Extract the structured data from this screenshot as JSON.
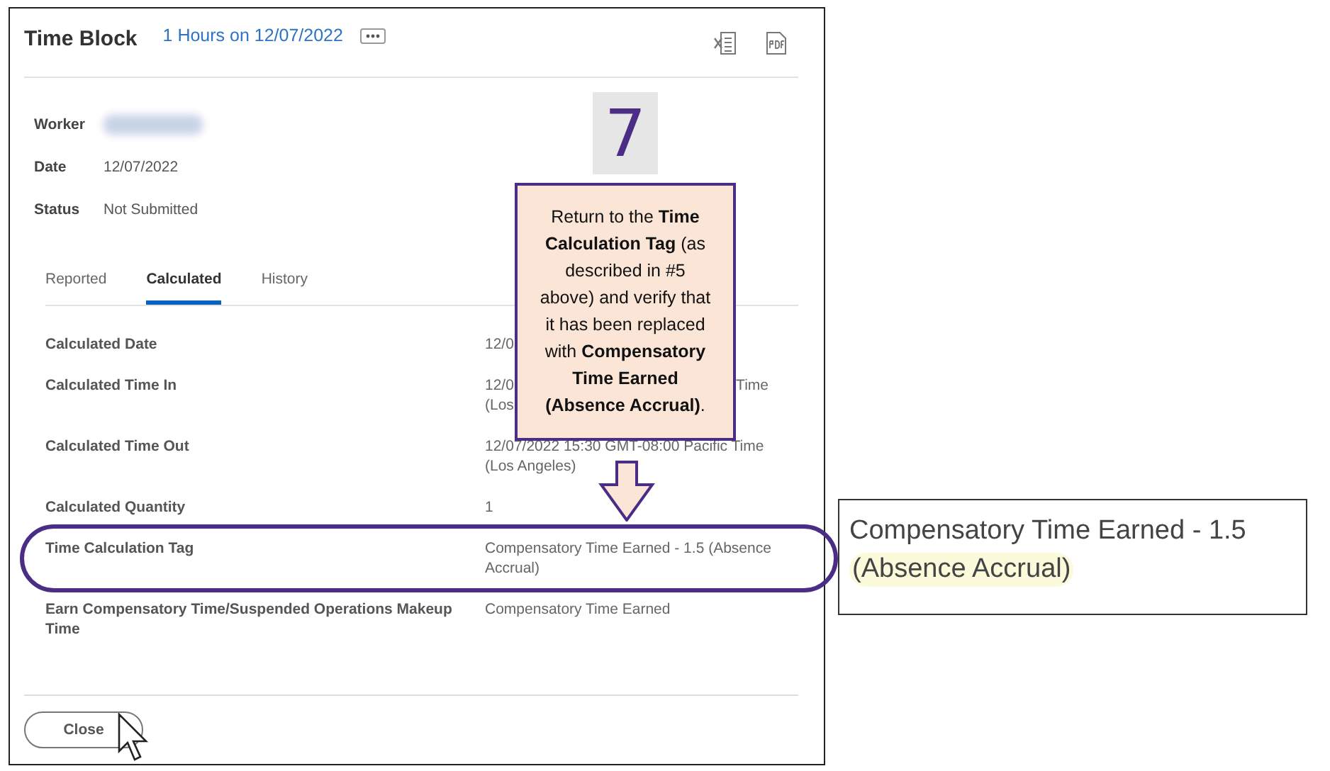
{
  "dialog": {
    "title": "Time Block",
    "subtitle_link": "1 Hours on 12/07/2022",
    "fields": [
      {
        "label": "Worker",
        "redacted": true
      },
      {
        "label": "Date",
        "value": "12/07/2022"
      },
      {
        "label": "Status",
        "value": "Not Submitted"
      }
    ],
    "tabs": [
      {
        "label": "Reported",
        "selected": false
      },
      {
        "label": "Calculated",
        "selected": true
      },
      {
        "label": "History",
        "selected": false
      }
    ],
    "rows": [
      {
        "label": "Calculated Date",
        "value_lines": [
          [
            "12/0"
          ]
        ],
        "highlighted": false
      },
      {
        "label": "Calculated Time In",
        "value_lines": [
          [
            "12/0",
            "Time"
          ],
          [
            "(Los"
          ]
        ],
        "highlighted": false
      },
      {
        "label": "Calculated Time Out",
        "value_lines": [
          [
            "12/07/2022 15:30 GMT-08:00 Pacific Time"
          ],
          [
            "(Los Angeles)"
          ]
        ],
        "highlighted": false
      },
      {
        "label": "Calculated Quantity",
        "value_lines": [
          [
            "1"
          ]
        ],
        "highlighted": false
      },
      {
        "label": "Time Calculation Tag",
        "value_lines": [
          [
            "Compensatory Time Earned - 1.5 (Absence"
          ],
          [
            "Accrual)"
          ]
        ],
        "highlighted": true
      },
      {
        "label": "Earn Compensatory Time/Suspended Operations Makeup Time",
        "value_lines": [
          [
            "Compensatory Time Earned"
          ]
        ],
        "highlighted": false
      }
    ],
    "close_button": "Close"
  },
  "annotation": {
    "step": "7",
    "callout": "Return to the **Time Calculation Tag** (as described in #5 above) and verify that it has been replaced with **Compensatory Time Earned (Absence Accrual)**."
  },
  "zoom_panel": {
    "line_1": "Compensatory Time Earned - 1.5",
    "highlight": "(Absence Accrual)"
  }
}
